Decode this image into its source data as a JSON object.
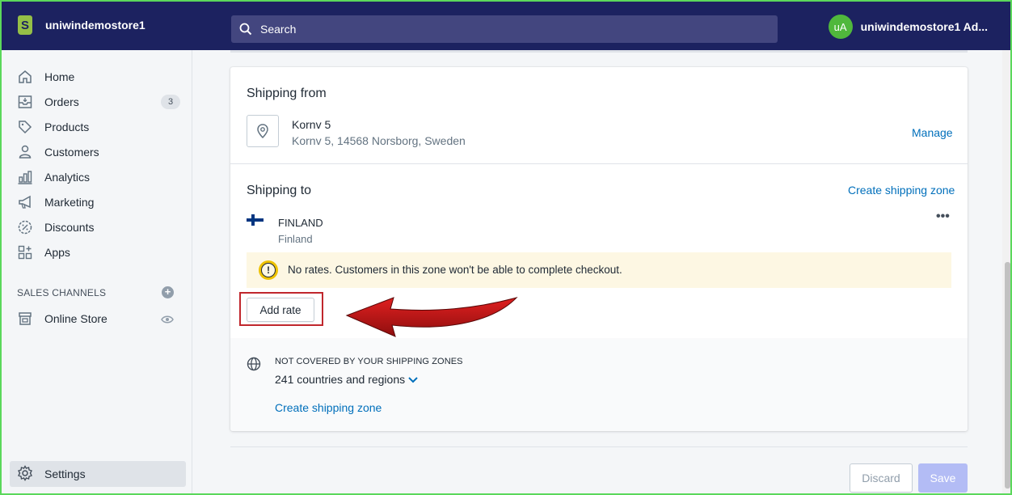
{
  "topbar": {
    "store_name": "uniwindemostore1",
    "search_placeholder": "Search",
    "avatar_initials": "uA",
    "account_name": "uniwindemostore1 Ad..."
  },
  "sidebar": {
    "items": [
      {
        "label": "Home",
        "icon": "home-icon"
      },
      {
        "label": "Orders",
        "icon": "orders-icon",
        "badge": "3"
      },
      {
        "label": "Products",
        "icon": "tag-icon"
      },
      {
        "label": "Customers",
        "icon": "person-icon"
      },
      {
        "label": "Analytics",
        "icon": "bar-chart-icon"
      },
      {
        "label": "Marketing",
        "icon": "megaphone-icon"
      },
      {
        "label": "Discounts",
        "icon": "discount-icon"
      },
      {
        "label": "Apps",
        "icon": "apps-icon"
      }
    ],
    "sales_channels_title": "SALES CHANNELS",
    "online_store": "Online Store",
    "settings": "Settings"
  },
  "shipping_from": {
    "title": "Shipping from",
    "location_name": "Kornv 5",
    "location_address": "Kornv 5, 14568 Norsborg, Sweden",
    "manage_link": "Manage"
  },
  "shipping_to": {
    "title": "Shipping to",
    "create_zone_link": "Create shipping zone",
    "zone_name": "FINLAND",
    "zone_country": "Finland",
    "more_actions": "•••",
    "warning_text": "No rates. Customers in this zone won't be able to complete checkout.",
    "add_rate_button": "Add rate"
  },
  "not_covered": {
    "title": "NOT COVERED BY YOUR SHIPPING ZONES",
    "count_text": "241 countries and regions",
    "create_zone_link": "Create shipping zone"
  },
  "footer": {
    "discard": "Discard",
    "save": "Save"
  },
  "colors": {
    "topbar": "#1c2260",
    "link": "#006fbb",
    "annotation_red": "#c0272d"
  }
}
